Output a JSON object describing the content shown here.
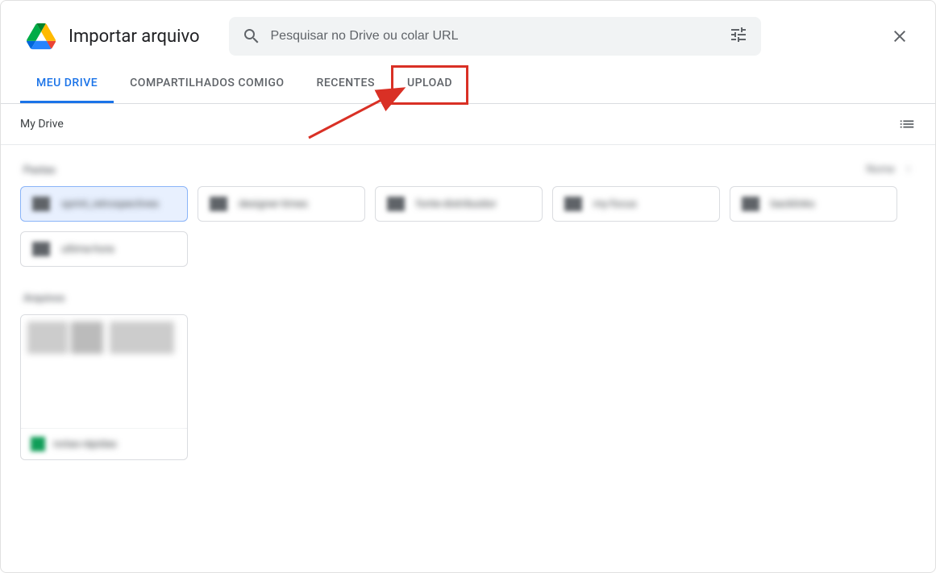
{
  "dialog": {
    "title": "Importar arquivo"
  },
  "search": {
    "placeholder": "Pesquisar no Drive ou colar URL",
    "value": ""
  },
  "tabs": {
    "my_drive": "MEU DRIVE",
    "shared": "COMPARTILHADOS COMIGO",
    "recent": "RECENTES",
    "upload": "UPLOAD"
  },
  "breadcrumb": "My Drive",
  "section": {
    "folders_label": "Pastas",
    "files_label": "Arquivos",
    "sort_label": "Nome",
    "sort_icon": "↑"
  },
  "folders": [
    {
      "name": "sprint_retrospectives"
    },
    {
      "name": "designer-times"
    },
    {
      "name": "fonte-distribuidor"
    },
    {
      "name": "my-focus"
    },
    {
      "name": "backlinks"
    },
    {
      "name": "ultima-hora"
    }
  ],
  "files": [
    {
      "name": "notas-rápidas"
    }
  ]
}
